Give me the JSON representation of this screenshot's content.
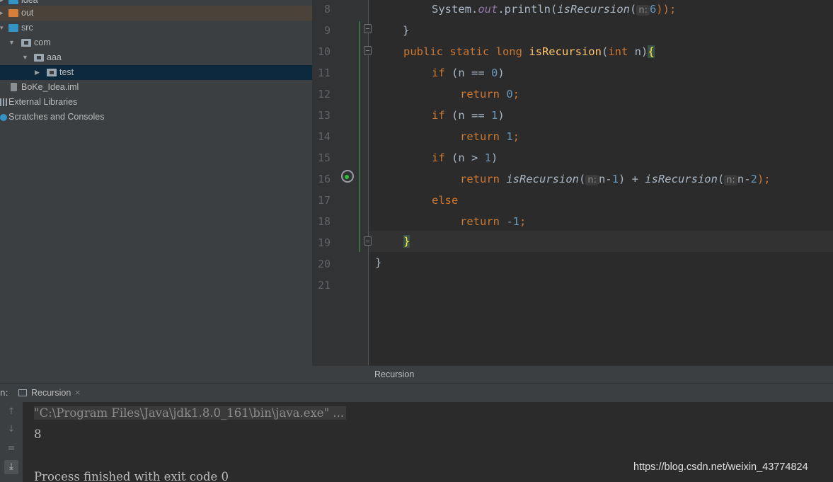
{
  "tree": {
    "items": [
      {
        "label": "idea"
      },
      {
        "label": "out"
      },
      {
        "label": "src"
      },
      {
        "label": "com"
      },
      {
        "label": "aaa"
      },
      {
        "label": "test"
      },
      {
        "label": "BoKe_Idea.iml"
      },
      {
        "label": "External Libraries"
      },
      {
        "label": "Scratches and Consoles"
      }
    ]
  },
  "editor": {
    "line_numbers": [
      "8",
      "9",
      "10",
      "11",
      "12",
      "13",
      "14",
      "15",
      "16",
      "17",
      "18",
      "19",
      "20",
      "21"
    ],
    "code": {
      "l8": {
        "system": "System.",
        "out": "out",
        "println": ".println(",
        "fn": "isRecursion",
        "paren": "(",
        "hint": "n:",
        "arg": "6",
        "close": "));"
      },
      "l9": {
        "text": "}"
      },
      "l10": {
        "kw": "public static long ",
        "fn": "isRecursion",
        "rest": "(",
        "kw2": "int",
        "param": " n)",
        "brace": "{"
      },
      "l11": {
        "kw": "if",
        "cond": " (n == ",
        "num": "0",
        "close": ")"
      },
      "l12": {
        "kw": "return ",
        "num": "0",
        "semi": ";"
      },
      "l13": {
        "kw": "if",
        "cond": " (n == ",
        "num": "1",
        "close": ")"
      },
      "l14": {
        "kw": "return ",
        "num": "1",
        "semi": ";"
      },
      "l15": {
        "kw": "if",
        "cond": " (n > ",
        "num": "1",
        "close": ")"
      },
      "l16": {
        "kw": "return ",
        "fn1": "isRecursion",
        "p1": "(",
        "hint1": "n:",
        "a1": "n-",
        "n1": "1",
        "mid": ") + ",
        "fn2": "isRecursion",
        "p2": "(",
        "hint2": "n:",
        "a2": "n-",
        "n2": "2",
        "end": ");"
      },
      "l17": {
        "kw": "else"
      },
      "l18": {
        "kw": "return ",
        "num": "-1",
        "semi": ";"
      },
      "l19": {
        "brace": "}"
      },
      "l20": {
        "text": "}"
      }
    },
    "breadcrumb": "Recursion"
  },
  "run_panel": {
    "prefix": "n:",
    "tab_label": "Recursion",
    "tab_close": "×",
    "output": {
      "command": "\"C:\\Program Files\\Java\\jdk1.8.0_161\\bin\\java.exe\" ...",
      "result": "8",
      "finished": "Process finished with exit code 0"
    }
  },
  "watermark": "https://blog.csdn.net/weixin_43774824",
  "colors": {
    "keyword": "#cc7832",
    "number": "#6897bb",
    "function": "#ffc66d",
    "field": "#9876aa",
    "text": "#a9b7c6",
    "selection": "#0d293e"
  }
}
